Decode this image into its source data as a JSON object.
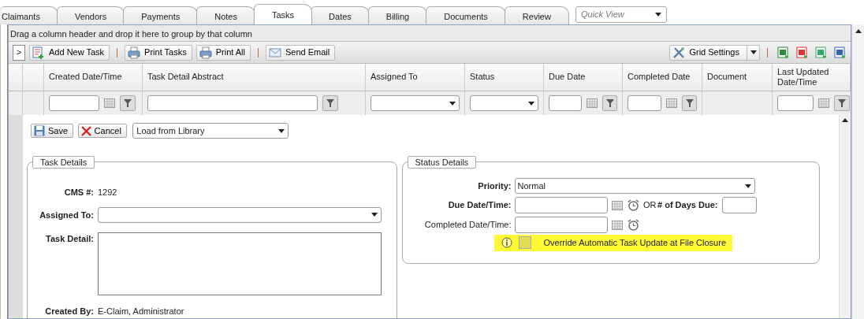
{
  "tabs": [
    {
      "label": "Claimants",
      "selected": false
    },
    {
      "label": "Vendors",
      "selected": false
    },
    {
      "label": "Payments",
      "selected": false
    },
    {
      "label": "Notes",
      "selected": false
    },
    {
      "label": "Tasks",
      "selected": true
    },
    {
      "label": "Dates",
      "selected": false
    },
    {
      "label": "Billing",
      "selected": false
    },
    {
      "label": "Documents",
      "selected": false
    },
    {
      "label": "Review",
      "selected": false
    }
  ],
  "quick_view": {
    "placeholder": "Quick View"
  },
  "group_panel": "Drag a column header and drop it here to group by that column",
  "toolbar": {
    "expander": ">",
    "buttons": [
      {
        "label": "Add New Task",
        "kind": "add",
        "separator_before": false
      },
      {
        "label": "Print Tasks",
        "kind": "print",
        "separator_before": true
      },
      {
        "label": "Print All",
        "kind": "print",
        "separator_before": false
      },
      {
        "label": "Send Email",
        "kind": "mail",
        "separator_before": true
      }
    ],
    "grid_settings": "Grid Settings",
    "exports": [
      {
        "kind": "excel"
      },
      {
        "kind": "pdf"
      },
      {
        "kind": "csv"
      },
      {
        "kind": "word"
      }
    ]
  },
  "columns": [
    {
      "label": "Created Date/Time",
      "kind": "date"
    },
    {
      "label": "Task Detail Abstract",
      "kind": "text"
    },
    {
      "label": "Assigned To",
      "kind": "select"
    },
    {
      "label": "Status",
      "kind": "select"
    },
    {
      "label": "Due Date",
      "kind": "date"
    },
    {
      "label": "Completed Date",
      "kind": "date"
    },
    {
      "label": "Document",
      "kind": "none"
    },
    {
      "label": "Last Updated Date/Time",
      "kind": "date"
    }
  ],
  "form": {
    "save": "Save",
    "cancel": "Cancel",
    "library": "Load from Library",
    "task_details": {
      "legend": "Task Details",
      "cms_label": "CMS #:",
      "cms_value": "1292",
      "assigned_label": "Assigned To:",
      "detail_label": "Task Detail:",
      "created_label": "Created By:",
      "created_value": "E-Claim, Administrator"
    },
    "status_details": {
      "legend": "Status Details",
      "priority_label": "Priority:",
      "priority_value": "Normal",
      "due_label": "Due Date/Time:",
      "or_text": "OR",
      "days_label": "# of Days Due:",
      "completed_label": "Completed Date/Time:",
      "override": {
        "label": "Override Automatic Task Update at File Closure",
        "checked": false
      }
    }
  }
}
